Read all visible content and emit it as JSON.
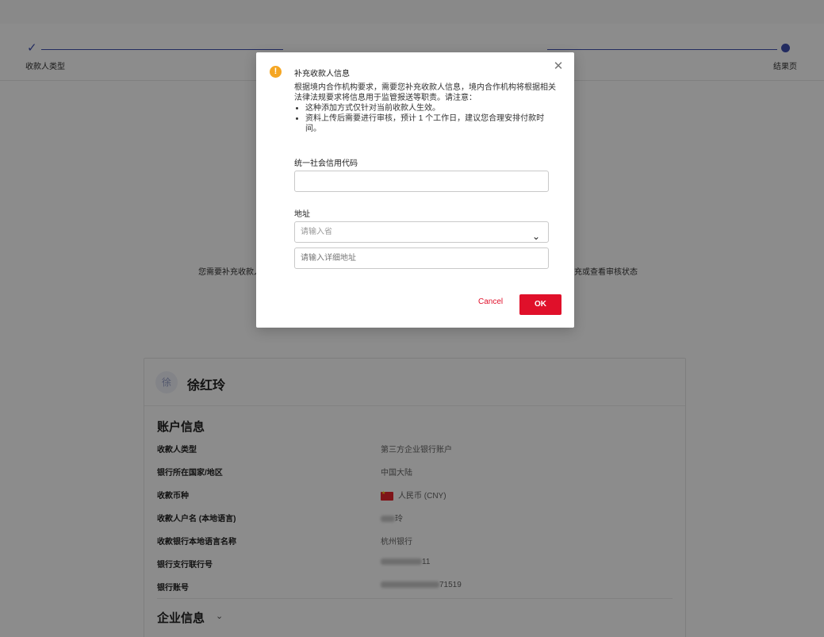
{
  "stepper": {
    "steps": [
      {
        "label": "收款人类型"
      },
      {
        "label": ""
      },
      {
        "label": ""
      },
      {
        "label": "结果页"
      }
    ]
  },
  "notice": {
    "left_text": "您需要补充收款人",
    "right_text": "充或查看审核状态"
  },
  "payee": {
    "avatar_text": "徐",
    "name": "徐红玲"
  },
  "account_info": {
    "title": "账户信息",
    "rows": [
      {
        "label": "收款人类型",
        "value": "第三方企业银行账户"
      },
      {
        "label": "银行所在国家/地区",
        "value": "中国大陆"
      },
      {
        "label": "收款币种",
        "value": "人民币 (CNY)"
      },
      {
        "label": "收款人户名 (本地语言)",
        "value": "玲"
      },
      {
        "label": "收款银行本地语言名称",
        "value": "杭州银行"
      },
      {
        "label": "银行支行联行号",
        "value": "11"
      },
      {
        "label": "银行账号",
        "value": "71519"
      }
    ]
  },
  "company_info": {
    "title": "企业信息"
  },
  "modal": {
    "title": "补充收款人信息",
    "description": "根据境内合作机构要求，需要您补充收款人信息，境内合作机构将根据相关法律法规要求将信息用于监管报送等职责。请注意：",
    "bullets": [
      "这种添加方式仅针对当前收款人生效。",
      "资料上传后需要进行审核，预计 1 个工作日，建议您合理安排付款时间。"
    ],
    "credit_code_label": "统一社会信用代码",
    "credit_code_value": "",
    "address_label": "地址",
    "province_placeholder": "请输入省",
    "detail_placeholder": "请输入详细地址",
    "cancel_label": "Cancel",
    "ok_label": "OK"
  },
  "colors": {
    "accent": "#3f4fb0",
    "primary_button": "#e0102a",
    "warning": "#f5a623"
  }
}
